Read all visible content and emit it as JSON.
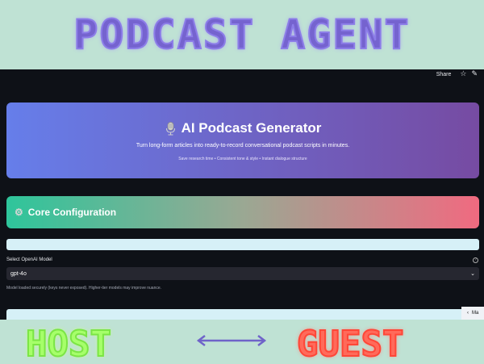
{
  "banner": {
    "title": "PODCAST AGENT",
    "host": "HOST",
    "guest": "GUEST",
    "arrow_icon": "double-arrow"
  },
  "topbar": {
    "share_label": "Share",
    "star_icon": "☆",
    "edit_icon": "✎"
  },
  "hero": {
    "title": "AI Podcast Generator",
    "subtitle": "Turn long-form articles into ready-to-record conversational podcast scripts in minutes.",
    "features": "Save research time • Consistent tone & style • Instant dialogue structure"
  },
  "core": {
    "icon": "⚙",
    "title": "Core Configuration"
  },
  "model": {
    "label": "Select OpenAI Model",
    "help_icon": "?",
    "selected": "gpt-4o",
    "chevron": "⌄",
    "help_text": "Model loaded securely (keys never exposed). Higher-tier models may improve nuance."
  },
  "sidebar_tab": {
    "arrow": "‹",
    "label": "Ma"
  },
  "colors": {
    "hero_start": "#667eea",
    "hero_end": "#764ba2",
    "core_start": "#2ec59b",
    "core_end": "#f06a80",
    "app_bg": "#0e1117"
  }
}
